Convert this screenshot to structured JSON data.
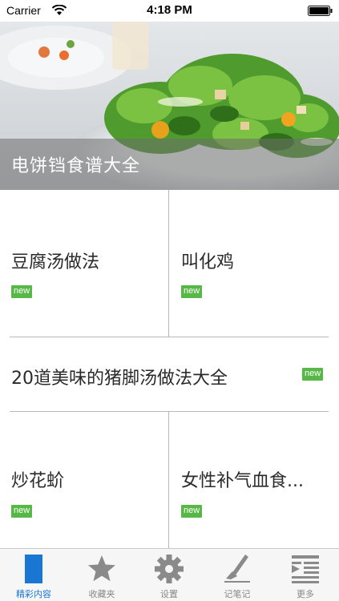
{
  "status_bar": {
    "carrier": "Carrier",
    "time": "4:18 PM"
  },
  "hero": {
    "title": "电饼铛食谱大全"
  },
  "items": [
    {
      "title": "豆腐汤做法",
      "badge": "new"
    },
    {
      "title": "叫化鸡",
      "badge": "new"
    },
    {
      "title": "20道美味的猪脚汤做法大全",
      "badge": "new"
    },
    {
      "title": "炒花蚧",
      "badge": "new"
    },
    {
      "title": "女性补气血食...",
      "badge": "new"
    }
  ],
  "tabs": [
    {
      "label": "精彩内容",
      "icon": "bookmark-icon",
      "active": true
    },
    {
      "label": "收藏夹",
      "icon": "star-icon"
    },
    {
      "label": "设置",
      "icon": "gear-icon"
    },
    {
      "label": "记笔记",
      "icon": "pen-icon"
    },
    {
      "label": "更多",
      "icon": "menu-icon"
    }
  ],
  "colors": {
    "accent": "#1976d2",
    "badge": "#58b847",
    "divider": "#b9b9b9"
  }
}
